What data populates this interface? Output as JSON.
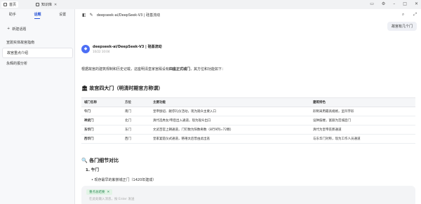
{
  "topbar": {
    "tabs": [
      {
        "label": "首页",
        "icon": "home-icon"
      },
      {
        "label": "知识库",
        "icon": "book-icon"
      }
    ],
    "window_buttons": [
      "layout-icon",
      "settings-icon",
      "minimize-icon",
      "maximize-icon",
      "close-icon"
    ]
  },
  "sidebar": {
    "tabs": [
      "助手",
      "话题",
      "设置"
    ],
    "active_tab": "话题",
    "new_chat_label": "新建话题",
    "conversations": [
      "宣鹃实体故宫指南",
      "故宫重点介绍",
      "永辉的报分析"
    ],
    "active_conversation": 1
  },
  "header": {
    "title": "deepseek-ai/DeepSeek-V3 | 硅基流动"
  },
  "chat": {
    "user_message": "故宫有几个门",
    "bot_name": "deepseek-ai/DeepSeek-V3 | 硅基流动",
    "bot_time": "10/22 10:04",
    "intro_prefix": "根据故宫的建筑规制和历史记载，这座明清皇家宫殿设有",
    "intro_bold": "四座正式城门",
    "intro_suffix": "，其方位和功能如下：",
    "section1_title": "🏛 故宫四大门（明清时期官方称谓）",
    "table": {
      "headers": [
        "城门名称",
        "方位",
        "主要功能",
        "",
        "建筑特色"
      ],
      "rows": [
        [
          "午门",
          "南门",
          "皇帝颁诏、献俘礼仪活动，现为观众主要入口",
          "",
          "形制采用最高规格，呈凹字形"
        ],
        [
          "神武门",
          "北门",
          "清代选秀女/帝后出入通道，现为观众出口",
          "",
          "设钟鼓楼，富丽为宫城后门"
        ],
        [
          "东华门",
          "东门",
          "文武百官上朝通道，门钉数为阳数奇数（8行9列=72颗）",
          "",
          "清代为皇帝丧葬通道"
        ],
        [
          "西华门",
          "西门",
          "皇家宴筵仪式通道，慈禧太后曾由此出逃",
          "",
          "与东华门对称，现为工作人员通道"
        ]
      ]
    },
    "section2_title": "🔍 各门细节对比",
    "subsection_title": "1. 午门",
    "bullet": "• 现存最早的紫禁城正门（1420年建成）"
  },
  "input": {
    "chip_label": "重点总结要",
    "placeholder": "在此处输入消息，按 Enter 发送"
  }
}
